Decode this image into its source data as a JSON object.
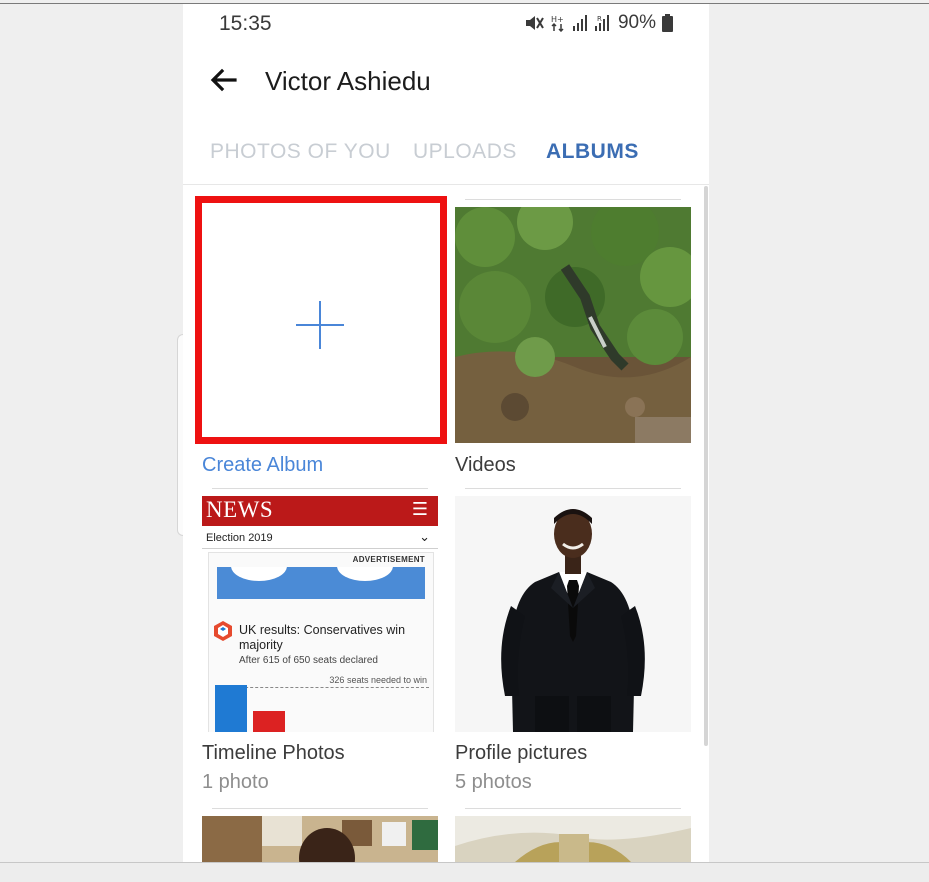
{
  "status_bar": {
    "time": "15:35",
    "battery": "90%"
  },
  "header": {
    "back_icon": "arrow-left-icon",
    "title": "Victor Ashiedu"
  },
  "tabs": [
    {
      "label": "PHOTOS OF YOU",
      "active": false
    },
    {
      "label": "UPLOADS",
      "active": false
    },
    {
      "label": "ALBUMS",
      "active": true
    }
  ],
  "albums": [
    {
      "label": "Create Album",
      "icon": "plus-icon",
      "highlighted": true
    },
    {
      "label": "Videos"
    },
    {
      "label": "Timeline Photos",
      "count": "1 photo"
    },
    {
      "label": "Profile pictures",
      "count": "5 photos"
    }
  ],
  "timeline_thumb": {
    "header": "NEWS",
    "menu_icon": "hamburger-icon",
    "dropdown": "Election 2019",
    "ad": "ADVERTISEMENT",
    "headline": "UK results: Conservatives win majority",
    "subline": "After 615 of 650 seats declared",
    "seats_note": "326 seats needed to win"
  },
  "colors": {
    "accent": "#3b6db3",
    "highlight_box": "#ee1111",
    "link": "#4a86d8",
    "news_red": "#bb1919"
  }
}
